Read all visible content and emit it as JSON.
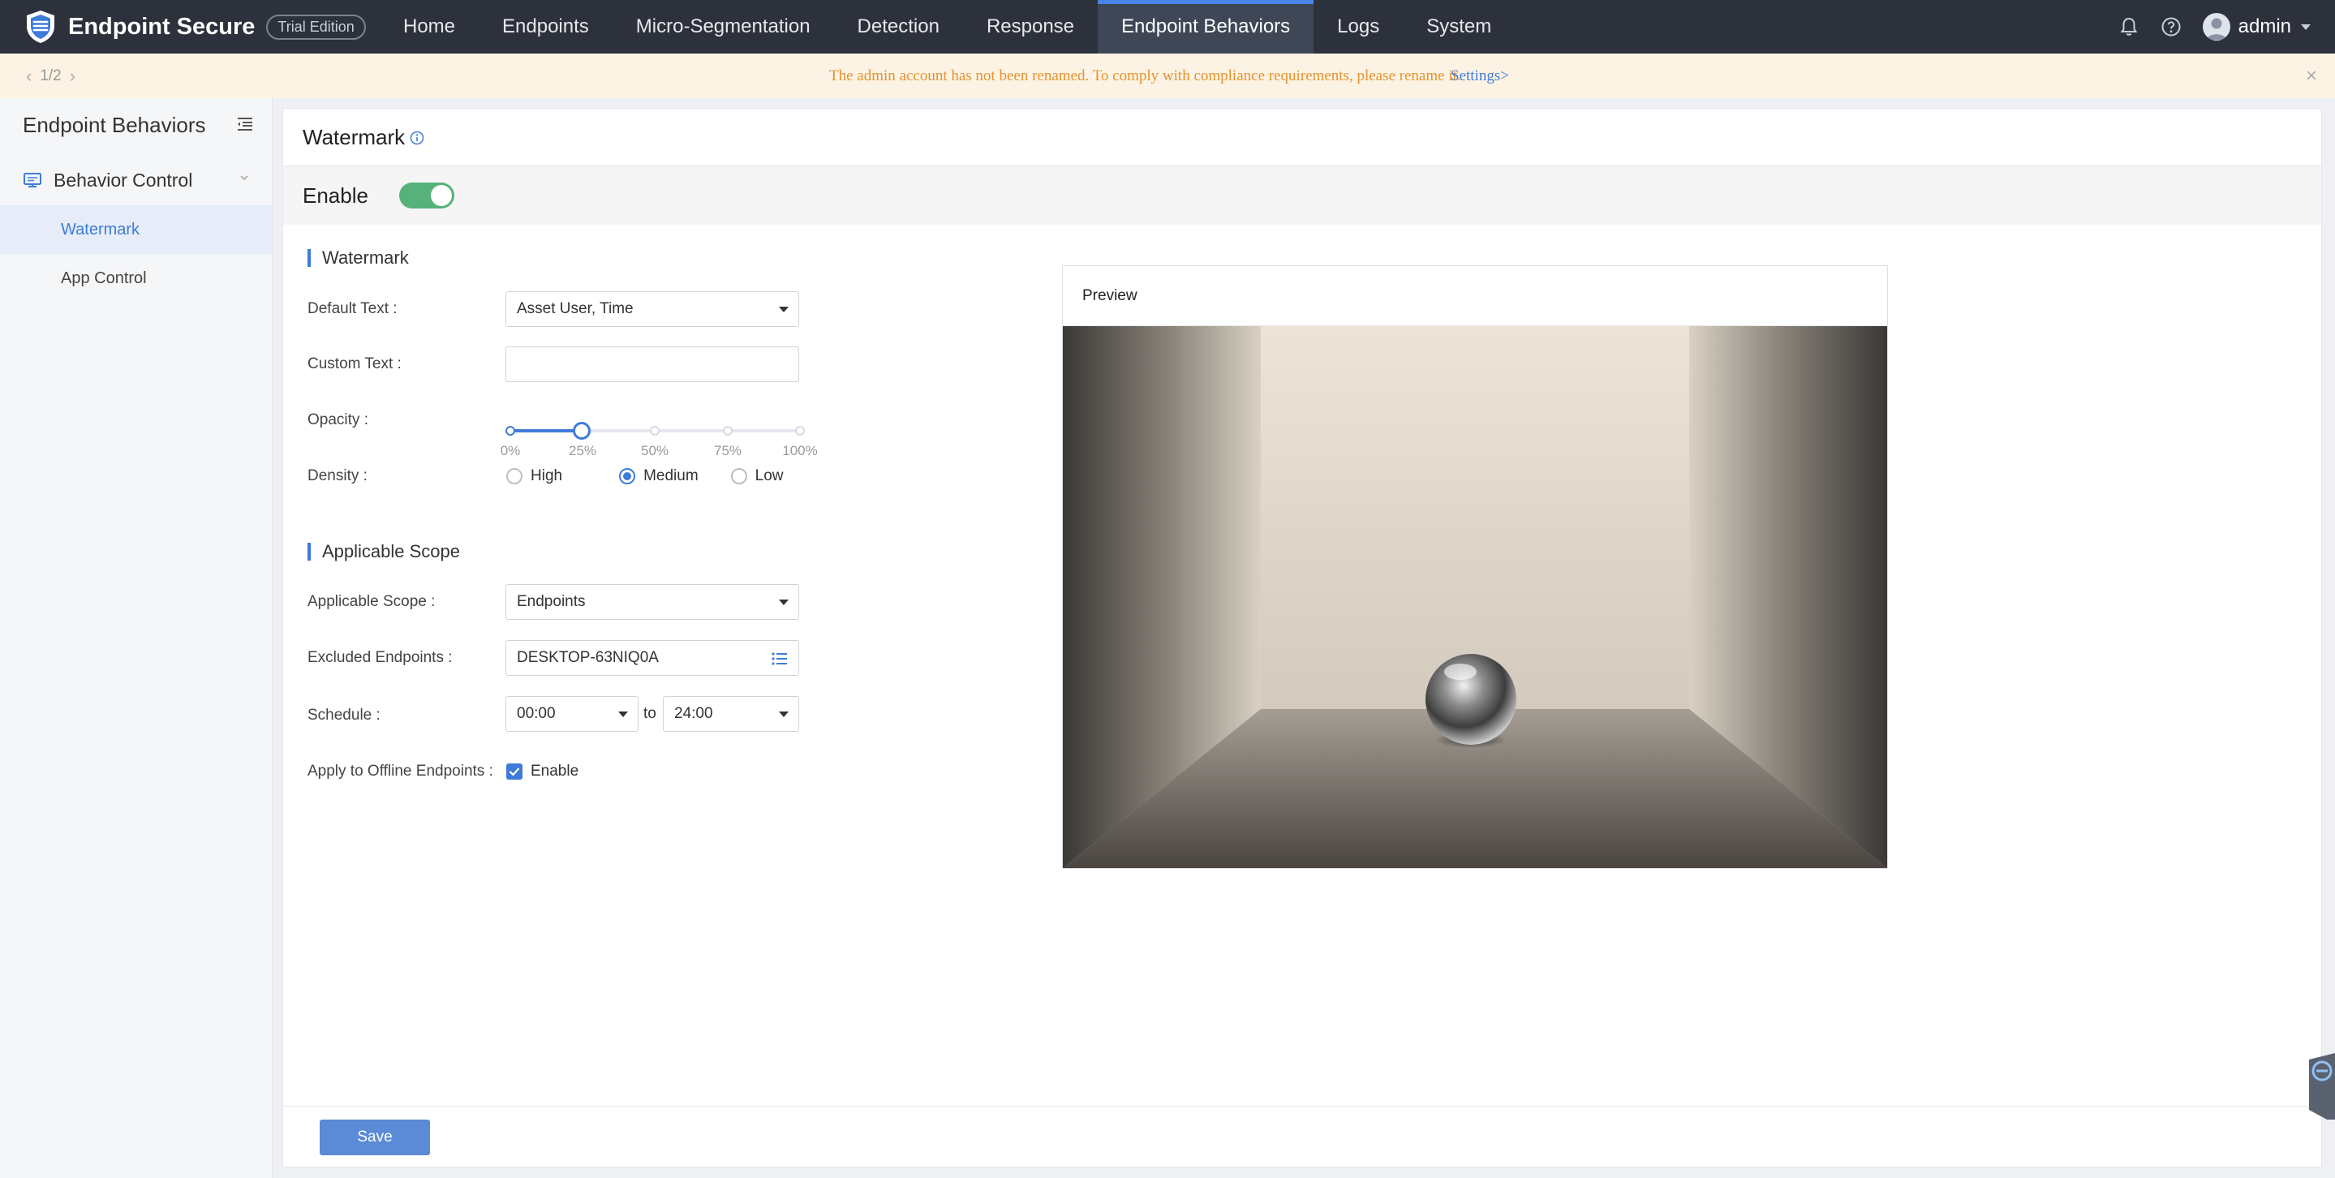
{
  "app": {
    "brand": "Endpoint Secure",
    "edition": "Trial Edition",
    "user": "admin"
  },
  "nav": {
    "items": [
      {
        "label": "Home",
        "active": false
      },
      {
        "label": "Endpoints",
        "active": false
      },
      {
        "label": "Micro-Segmentation",
        "active": false
      },
      {
        "label": "Detection",
        "active": false
      },
      {
        "label": "Response",
        "active": false
      },
      {
        "label": "Endpoint Behaviors",
        "active": true
      },
      {
        "label": "Logs",
        "active": false
      },
      {
        "label": "System",
        "active": false
      }
    ]
  },
  "notice": {
    "pager": "1/2",
    "text": "The admin account has not been renamed. To comply with compliance requirements, please rename it.",
    "link": "Settings>"
  },
  "sidebar": {
    "title": "Endpoint Behaviors",
    "group_label": "Behavior Control",
    "items": [
      {
        "label": "Watermark",
        "active": true
      },
      {
        "label": "App Control",
        "active": false
      }
    ]
  },
  "page": {
    "title": "Watermark",
    "enable_label": "Enable",
    "enabled": true
  },
  "watermark": {
    "section_title": "Watermark",
    "default_text_label": "Default Text :",
    "default_text_value": "Asset User, Time",
    "custom_text_label": "Custom Text :",
    "custom_text_value": "",
    "opacity_label": "Opacity :",
    "opacity_value_percent": 25,
    "opacity_ticks": [
      "0%",
      "25%",
      "50%",
      "75%",
      "100%"
    ],
    "density_label": "Density :",
    "density_options": [
      "High",
      "Medium",
      "Low"
    ],
    "density_selected": "Medium"
  },
  "scope": {
    "section_title": "Applicable Scope",
    "scope_label": "Applicable Scope :",
    "scope_value": "Endpoints",
    "excluded_label": "Excluded Endpoints :",
    "excluded_value": "DESKTOP-63NIQ0A",
    "schedule_label": "Schedule :",
    "schedule_from": "00:00",
    "schedule_to_word": "to",
    "schedule_to": "24:00",
    "offline_label": "Apply to Offline Endpoints :",
    "offline_checkbox_label": "Enable",
    "offline_checked": true
  },
  "preview": {
    "title": "Preview"
  },
  "footer": {
    "save_label": "Save"
  },
  "colors": {
    "accent": "#3f7bd8",
    "nav_bg": "#2c313c",
    "toggle_on": "#56b27a",
    "notice_text": "#e6922e"
  }
}
